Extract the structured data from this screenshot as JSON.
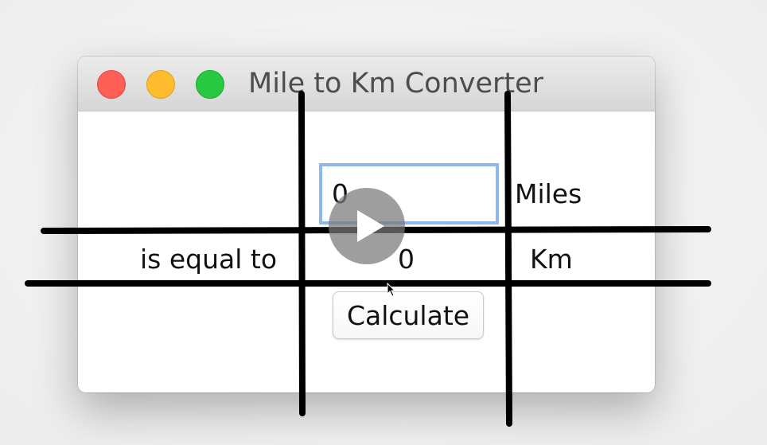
{
  "window": {
    "title": "Mile to Km Converter"
  },
  "form": {
    "miles_value": "0",
    "miles_unit_label": "Miles",
    "equal_label": "is equal to",
    "result_value": "0",
    "km_unit_label": "Km",
    "calculate_label": "Calculate"
  },
  "overlay": {
    "play_icon": "play-icon",
    "cursor_icon": "cursor-arrow-icon",
    "grid_line_color": "#000000"
  },
  "colors": {
    "close": "#fe5f57",
    "minimize": "#febc2e",
    "maximize": "#28c840",
    "focus_ring": "#8db8ec"
  }
}
